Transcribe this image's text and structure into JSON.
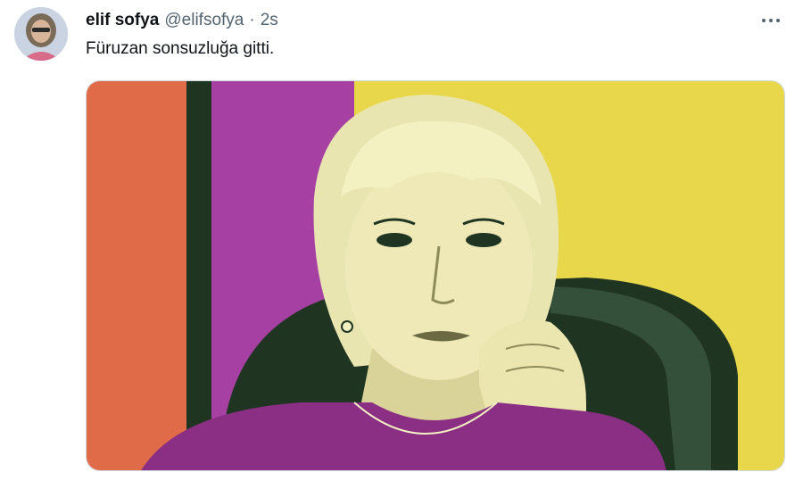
{
  "tweet": {
    "author": {
      "display_name": "elif sofya",
      "handle": "@elifsofya",
      "separator": "·",
      "time_ago": "2s"
    },
    "text": "Füruzan sonsuzluğa gitti.",
    "more_icon": "more-horizontal-icon",
    "media": {
      "kind": "image",
      "stripe_colors": [
        "#e06b49",
        "#a640a2",
        "#e8d74a"
      ],
      "duotone_dark": "#1f3522",
      "duotone_light": "#f3f0c2"
    }
  }
}
